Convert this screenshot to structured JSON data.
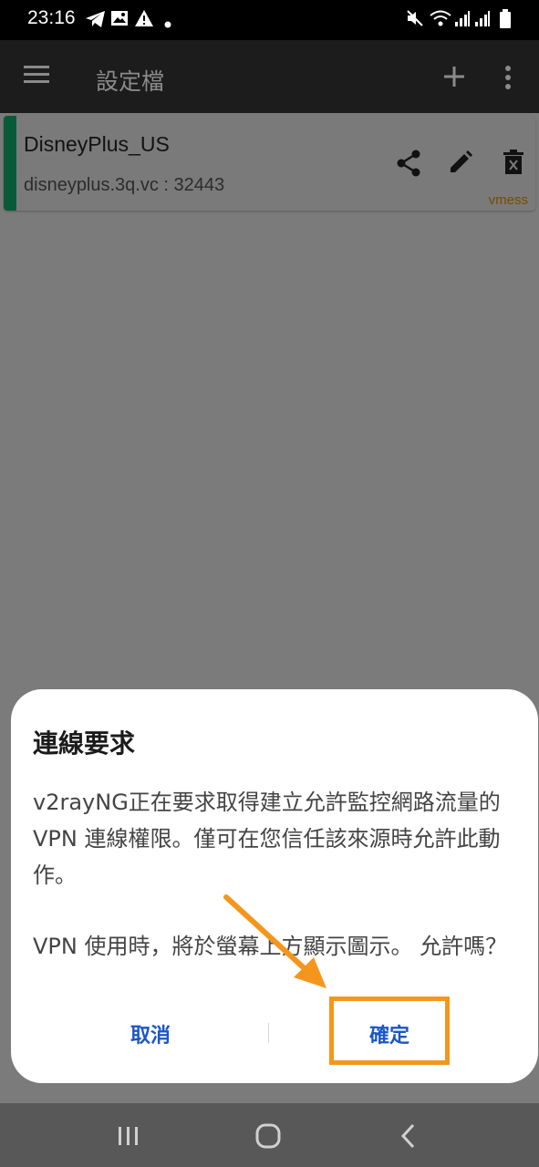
{
  "status_bar": {
    "time": "23:16",
    "left_icons": [
      "telegram-icon",
      "image-icon",
      "warning-icon",
      "dot-icon"
    ],
    "right_icons": [
      "mute-icon",
      "wifi-icon",
      "signal-icon",
      "signal-icon",
      "battery-icon"
    ]
  },
  "app_bar": {
    "menu_icon": "menu-icon",
    "title": "設定檔",
    "add_icon": "add-icon",
    "more_icon": "more-icon"
  },
  "server": {
    "name": "DisneyPlus_US",
    "address": "disneyplus.3q.vc : 32443",
    "type": "vmess",
    "actions": [
      "share-icon",
      "edit-icon",
      "delete-icon"
    ]
  },
  "dialog": {
    "title": "連線要求",
    "message_1": "v2rayNG正在要求取得建立允許監控網路流量的 VPN 連線權限。僅可在您信任該來源時允許此動作。",
    "message_2": "VPN 使用時，將於螢幕上方顯示圖示。 允許嗎？",
    "cancel_label": "取消",
    "confirm_label": "確定"
  },
  "annotation": {
    "color": "#f5961c"
  },
  "nav_bar": {
    "icons": [
      "recents-icon",
      "home-icon",
      "back-icon"
    ]
  },
  "colors": {
    "accent": "#1a56c6",
    "card_accent": "#0a5a3a",
    "type_label": "#7a4a00"
  }
}
